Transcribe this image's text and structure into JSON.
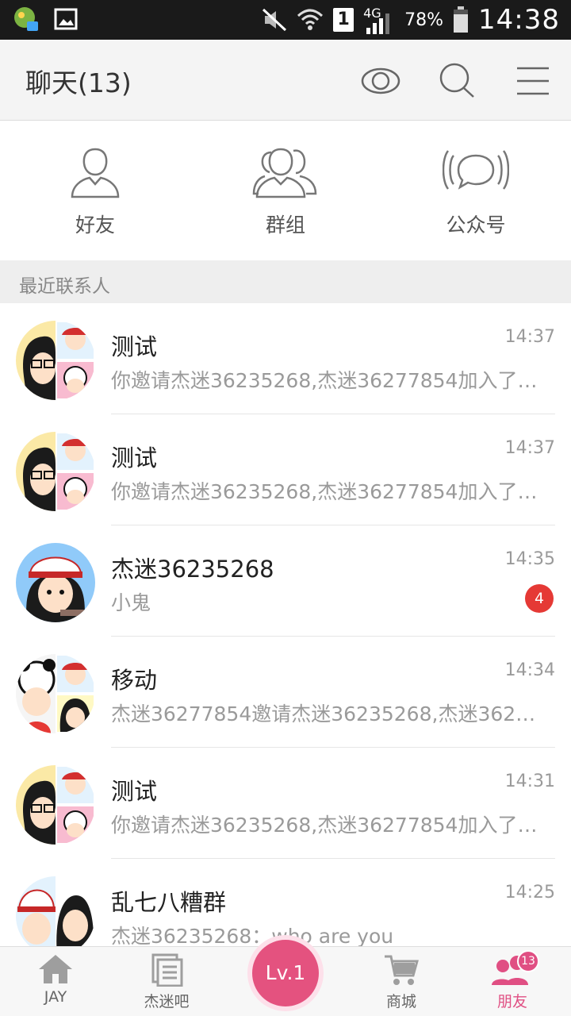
{
  "status_bar": {
    "battery": "78%",
    "time": "14:38",
    "network": "4G",
    "sim_slot": "1"
  },
  "header": {
    "title": "聊天(13)",
    "icons": [
      "eye-icon",
      "search-icon",
      "menu-icon"
    ]
  },
  "categories": [
    {
      "label": "好友",
      "icon": "person-icon"
    },
    {
      "label": "群组",
      "icon": "group-icon"
    },
    {
      "label": "公众号",
      "icon": "broadcast-icon"
    }
  ],
  "recent": {
    "label": "最近联系人",
    "chats": [
      {
        "name": "测试",
        "time": "14:37",
        "preview": "你邀请杰迷36235268,杰迷36277854加入了群聊",
        "badge": "",
        "avatar": "group-avatar"
      },
      {
        "name": "测试",
        "time": "14:37",
        "preview": "你邀请杰迷36235268,杰迷36277854加入了群聊",
        "badge": "",
        "avatar": "group-avatar"
      },
      {
        "name": "杰迷36235268",
        "time": "14:35",
        "preview": "小鬼",
        "badge": "4",
        "avatar": "user-avatar"
      },
      {
        "name": "移动",
        "time": "14:34",
        "preview": "杰迷36277854邀请杰迷36235268,杰迷36235268加入了群聊",
        "badge": "",
        "avatar": "group-avatar"
      },
      {
        "name": "测试",
        "time": "14:31",
        "preview": "你邀请杰迷36235268,杰迷36277854加入了群聊",
        "badge": "",
        "avatar": "group-avatar"
      },
      {
        "name": "乱七八糟群",
        "time": "14:25",
        "preview": "杰迷36235268：who are you",
        "badge": "",
        "avatar": "group-avatar"
      }
    ]
  },
  "tabbar": {
    "tabs": [
      {
        "label": "JAY",
        "icon": "home-icon",
        "active": false
      },
      {
        "label": "杰迷吧",
        "icon": "forum-icon",
        "active": false
      },
      {
        "label": "商城",
        "icon": "cart-icon",
        "active": false
      },
      {
        "label": "朋友",
        "icon": "friends-icon",
        "active": true,
        "badge": "13"
      }
    ],
    "level_button": "Lv.1"
  },
  "colors": {
    "accent": "#e4527f",
    "badge_red": "#e53935",
    "header_bg": "#f4f4f4"
  }
}
